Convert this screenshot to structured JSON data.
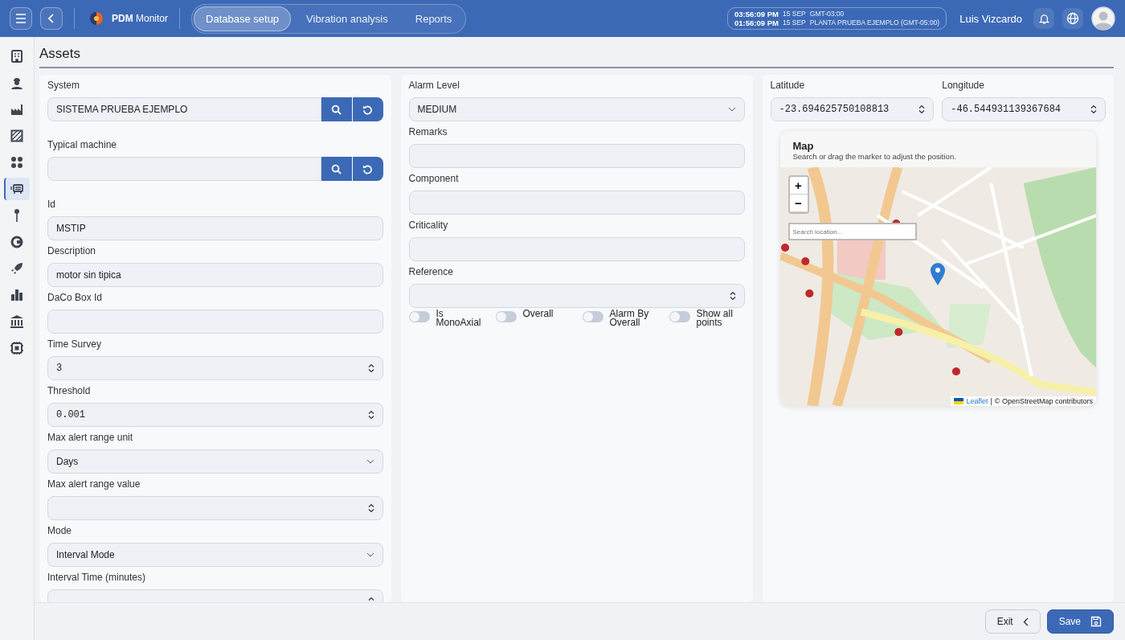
{
  "header": {
    "brand": "**PDM** Monitor",
    "tabs": [
      {
        "label": "Database setup",
        "selected": true
      },
      {
        "label": "Vibration analysis",
        "selected": false
      },
      {
        "label": "Reports",
        "selected": false
      }
    ],
    "clock": [
      {
        "time": "03:56:09 PM",
        "date": "15 SEP",
        "zone": "GMT-03:00"
      },
      {
        "time": "01:56:09 PM",
        "date": "15 SEP",
        "zone": "PLANTA PRUEBA EJEMPLO (GMT-05:00)"
      }
    ],
    "user": "Luis Vizcardo"
  },
  "sidebar": {
    "items": [
      {
        "selected": false
      },
      {
        "selected": false
      },
      {
        "selected": false
      },
      {
        "selected": false
      },
      {
        "selected": false
      },
      {
        "selected": true
      },
      {
        "selected": false
      },
      {
        "selected": false
      },
      {
        "selected": false
      },
      {
        "selected": false
      },
      {
        "selected": false
      },
      {
        "selected": false
      }
    ]
  },
  "page_title": "Assets",
  "left_panel": {
    "fields": [
      {
        "kind": "lookup",
        "label": "System",
        "value": "SISTEMA PRUEBA EJEMPLO"
      },
      {
        "kind": "lookup",
        "label": "Typical machine"
      },
      {
        "kind": "text",
        "label": "Id",
        "value": "MSTIP"
      },
      {
        "kind": "text",
        "label": "Description",
        "value": "motor sin tipica"
      },
      {
        "kind": "text",
        "label": "DaCo Box Id"
      },
      {
        "kind": "number",
        "label": "Time Survey",
        "value": "3"
      },
      {
        "kind": "number",
        "label": "Threshold",
        "value": "0.001"
      },
      {
        "kind": "select",
        "label": "Max alert range unit",
        "value": "Days"
      },
      {
        "kind": "number",
        "label": "Max alert range value"
      },
      {
        "kind": "select",
        "label": "Mode",
        "value": "Interval Mode"
      },
      {
        "kind": "number",
        "label": "Interval Time (minutes)"
      }
    ]
  },
  "middle_panel": {
    "fields": [
      {
        "kind": "select",
        "label": "Alarm Level",
        "value": "MEDIUM"
      },
      {
        "kind": "text",
        "label": "Remarks"
      },
      {
        "kind": "text",
        "label": "Component"
      },
      {
        "kind": "text",
        "label": "Criticality"
      },
      {
        "kind": "number",
        "label": "Reference"
      }
    ],
    "toggles": [
      {
        "label": "Is MonoAxial",
        "on": false
      },
      {
        "label": "Overall",
        "on": false
      },
      {
        "label": "Alarm By Overall",
        "on": false
      },
      {
        "label": "Show all points",
        "on": false
      }
    ]
  },
  "right_panel": {
    "fields": [
      {
        "label": "Latitude",
        "value": "-23.694625750108813"
      },
      {
        "label": "Longitude",
        "value": "-46.544931139367684"
      }
    ],
    "map": {
      "title": "Map",
      "subtitle": "Search or drag the marker to adjust the position.",
      "zoom_in": "+",
      "zoom_out": "−",
      "search_placeholder": "Search location...",
      "attribution_link": "Leaflet",
      "attribution_separator": "|",
      "attribution_text": "© OpenStreetMap contributors"
    }
  },
  "footer": {
    "buttons": [
      {
        "kind": "exit",
        "label": "Exit"
      },
      {
        "kind": "save",
        "label": "Save"
      }
    ]
  }
}
